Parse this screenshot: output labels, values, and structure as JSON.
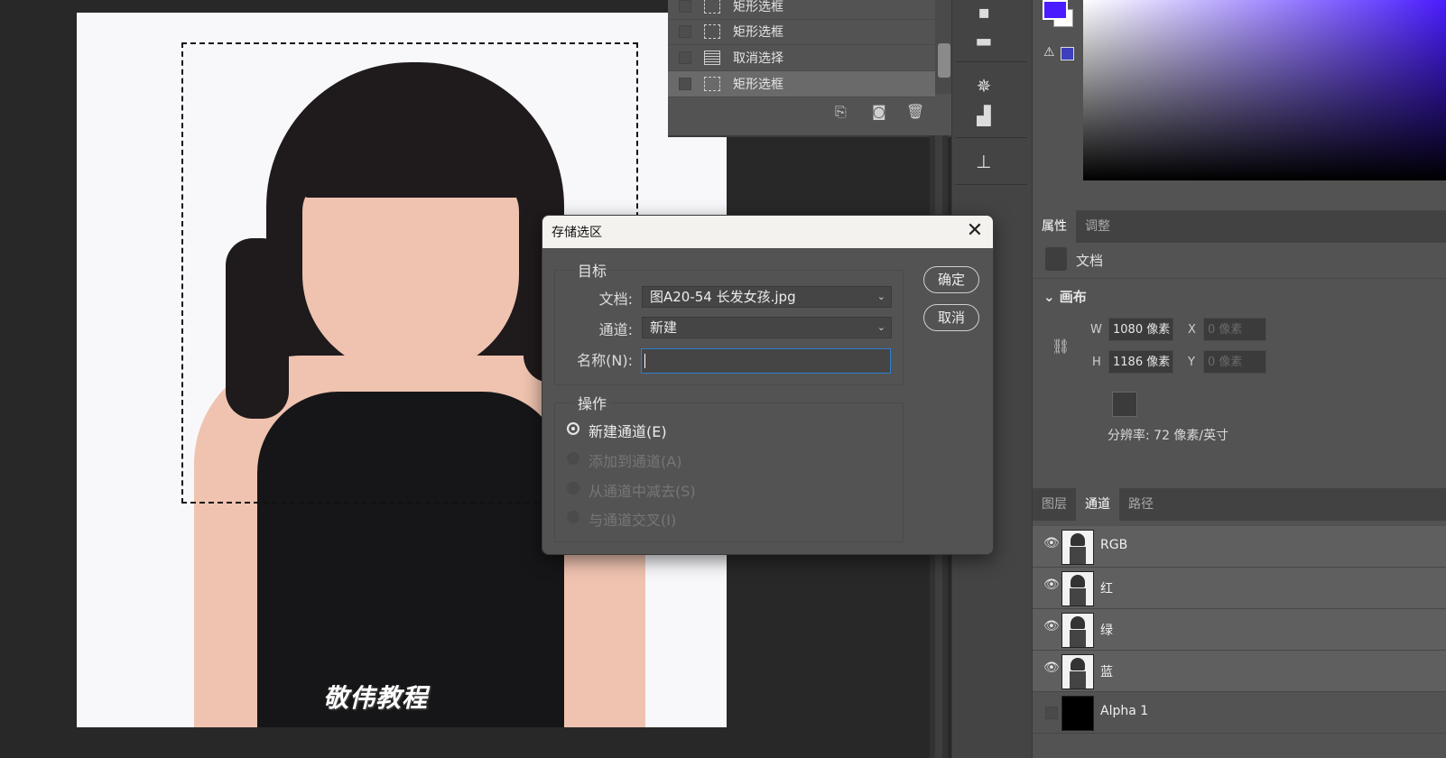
{
  "history": {
    "items": [
      {
        "label": "矩形选框",
        "icon": "marquee-icon",
        "selected": false
      },
      {
        "label": "矩形选框",
        "icon": "marquee-icon",
        "selected": false
      },
      {
        "label": "取消选择",
        "icon": "document-icon",
        "selected": false
      },
      {
        "label": "矩形选框",
        "icon": "marquee-icon",
        "selected": true
      }
    ]
  },
  "canvas": {
    "watermark": "敬伟教程"
  },
  "colors": {
    "foreground": "#4a1cff",
    "background": "#ffffff",
    "accent": "#2d7ed0"
  },
  "properties": {
    "tabs": [
      {
        "label": "属性",
        "active": true
      },
      {
        "label": "调整",
        "active": false
      }
    ],
    "doc_label": "文档",
    "canvas_header": "画布",
    "w_label": "W",
    "w_value": "1080 像素",
    "h_label": "H",
    "h_value": "1186 像素",
    "x_label": "X",
    "x_placeholder": "0 像素",
    "y_label": "Y",
    "y_placeholder": "0 像素",
    "resolution": "分辨率: 72 像素/英寸"
  },
  "channels": {
    "tabs": [
      {
        "label": "图层",
        "active": false
      },
      {
        "label": "通道",
        "active": true
      },
      {
        "label": "路径",
        "active": false
      }
    ],
    "rows": [
      {
        "name": "RGB",
        "visible": true
      },
      {
        "name": "红",
        "visible": true
      },
      {
        "name": "绿",
        "visible": true
      },
      {
        "name": "蓝",
        "visible": true
      },
      {
        "name": "Alpha 1",
        "visible": false
      }
    ]
  },
  "dialog": {
    "title": "存储选区",
    "close": "✕",
    "target_group": "目标",
    "doc_label": "文档:",
    "doc_value": "图A20-54 长发女孩.jpg",
    "channel_label": "通道:",
    "channel_value": "新建",
    "name_label": "名称(N):",
    "name_value": "",
    "ok": "确定",
    "cancel": "取消",
    "operation_group": "操作",
    "operations": [
      {
        "label": "新建通道(E)",
        "checked": true,
        "enabled": true
      },
      {
        "label": "添加到通道(A)",
        "checked": false,
        "enabled": false
      },
      {
        "label": "从通道中减去(S)",
        "checked": false,
        "enabled": false
      },
      {
        "label": "与通道交叉(I)",
        "checked": false,
        "enabled": false
      }
    ]
  }
}
